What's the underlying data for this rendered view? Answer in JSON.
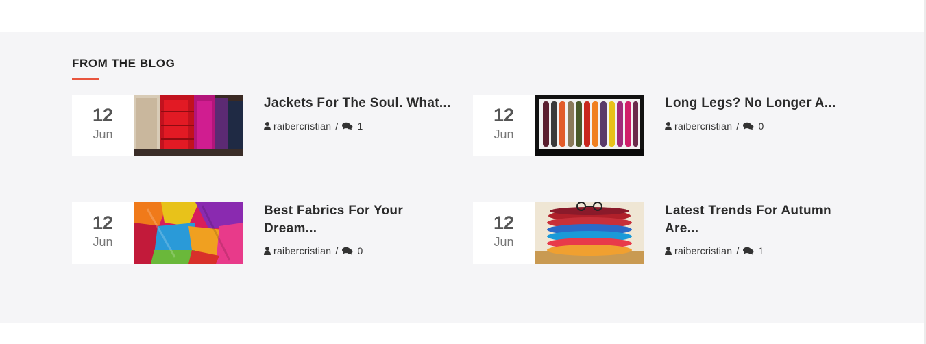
{
  "section": {
    "title": "FROM THE BLOG",
    "accent_color": "#e8553e",
    "background": "#f5f5f7"
  },
  "posts": [
    {
      "day": "12",
      "month": "Jun",
      "title": "Jackets For The Soul. What...",
      "author": "raibercristian",
      "separator": "/",
      "comments": "1",
      "image": "puffer-jackets-photo"
    },
    {
      "day": "12",
      "month": "Jun",
      "title": "Long Legs? No Longer A...",
      "author": "raibercristian",
      "separator": "/",
      "comments": "0",
      "image": "colored-tights-photo"
    },
    {
      "day": "12",
      "month": "Jun",
      "title": "Best Fabrics For Your Dream...",
      "author": "raibercristian",
      "separator": "/",
      "comments": "0",
      "image": "colorful-fabrics-photo"
    },
    {
      "day": "12",
      "month": "Jun",
      "title": "Latest Trends For Autumn Are...",
      "author": "raibercristian",
      "separator": "/",
      "comments": "1",
      "image": "stacked-sweaters-photo"
    }
  ],
  "icons": {
    "author": "user-icon",
    "comments": "comments-icon"
  }
}
